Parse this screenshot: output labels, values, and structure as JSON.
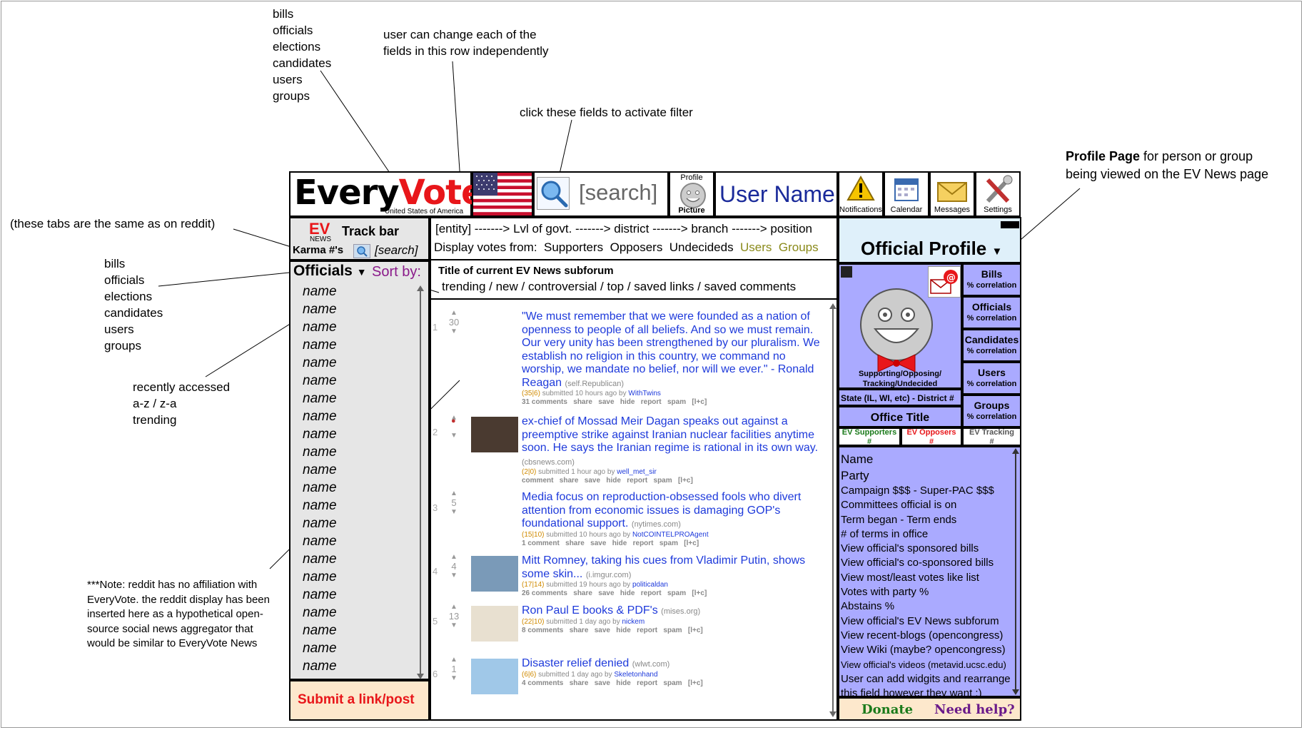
{
  "annotations": {
    "entity_types_top": "bills\nofficials\nelections\ncandidates\nusers\ngroups",
    "fields_note": "user can change each of the\nfields in this row independently",
    "filter_note": "click these fields to activate filter",
    "profile_note_bold": "Profile Page",
    "profile_note_rest": " for person or group\nbeing viewed on the EV News page",
    "tabs_note": "(these tabs are the same as on reddit)",
    "entity_types_left": "bills\nofficials\nelections\ncandidates\nusers\ngroups",
    "sort_note": "recently accessed\na-z / z-a\ntrending",
    "reddit_note": "***Note: reddit has no affiliation with\nEveryVote. the reddit display has been\ninserted here as a hypothetical open-\nsource social news aggregator that\nwould be similar to EveryVote News"
  },
  "header": {
    "logo_every": "Every",
    "logo_vote": "Vote",
    "logo_sub": "United States of America",
    "search_placeholder": "[search]",
    "profile_top": "Profile",
    "profile_bottom": "Picture",
    "user_name": "User Name",
    "icons": [
      {
        "icon": "warning-icon",
        "label": "Notifications"
      },
      {
        "icon": "calendar-icon",
        "label": "Calendar"
      },
      {
        "icon": "envelope-icon",
        "label": "Messages"
      },
      {
        "icon": "tools-icon",
        "label": "Settings"
      }
    ]
  },
  "trackbar": {
    "ev": "EV",
    "news": "NEWS",
    "title": "Track bar",
    "karma": "Karma #'s",
    "search": "[search]"
  },
  "filters": {
    "path": "[entity] -------> Lvl of govt. -------> district -------> branch -------> position",
    "display_label": "Display votes from:",
    "supporters": "Supporters",
    "opposers": "Opposers",
    "undecideds": "Undecideds",
    "users": "Users",
    "groups": "Groups"
  },
  "sidebar": {
    "title": "Officials",
    "sort_by": "Sort by:",
    "items": [
      "name",
      "name",
      "name",
      "name",
      "name",
      "name",
      "name",
      "name",
      "name",
      "name",
      "name",
      "name",
      "name",
      "name",
      "name",
      "name",
      "name",
      "name",
      "name",
      "name",
      "name",
      "name"
    ],
    "submit": "Submit a link/post"
  },
  "subforum": {
    "title": "Title of current EV News subforum",
    "tabs": "trending / new / controversial / top / saved links / saved comments"
  },
  "links": [
    {
      "rank": "1",
      "score": "30",
      "title": "\"We must remember that we were founded as a nation of openness to people of all beliefs. And so we must remain. Our very unity has been strengthened by our pluralism. We establish no religion in this country, we command no worship, we mandate no belief, nor will we ever.\" - Ronald Reagan",
      "domain": "(self.Republican)",
      "points": "(35|6)",
      "submitted": "submitted 10 hours ago by",
      "user": "WithTwins",
      "actions": "31 comments   share   save   hide   report   spam   [l+c]"
    },
    {
      "rank": "2",
      "score": "",
      "title": "ex-chief of Mossad Meir Dagan speaks out against a preemptive strike against Iranian nuclear facilities anytime soon. He says the Iranian regime is rational in its own way.",
      "domain": "(cbsnews.com)",
      "points": "(2|0)",
      "submitted": "submitted 1 hour ago by",
      "user": "well_met_sir",
      "actions": "comment   share   save   hide   report   spam   [l+c]"
    },
    {
      "rank": "3",
      "score": "5",
      "title": "Media focus on reproduction-obsessed fools who divert attention from economic issues is damaging GOP's foundational support.",
      "domain": "(nytimes.com)",
      "points": "(15|10)",
      "submitted": "submitted 10 hours ago by",
      "user": "NotCOINTELPROAgent",
      "actions": "1 comment   share   save   hide   report   spam   [l+c]"
    },
    {
      "rank": "4",
      "score": "4",
      "title": "Mitt Romney, taking his cues from Vladimir Putin, shows some skin...",
      "domain": "(i.imgur.com)",
      "points": "(17|14)",
      "submitted": "submitted 19 hours ago by",
      "user": "politicaldan",
      "actions": "26 comments   share   save   hide   report   spam   [l+c]"
    },
    {
      "rank": "5",
      "score": "13",
      "title": "Ron Paul E books & PDF's",
      "domain": "(mises.org)",
      "points": "(22|10)",
      "submitted": "submitted 1 day ago by",
      "user": "nickem",
      "actions": "8 comments   share   save   hide   report   spam   [l+c]"
    },
    {
      "rank": "6",
      "score": "1",
      "title": "Disaster relief denied",
      "domain": "(wlwt.com)",
      "points": "(6|6)",
      "submitted": "submitted 1 day ago by",
      "user": "Skeletonhand",
      "actions": "4 comments   share   save   hide   report   spam   [l+c]"
    }
  ],
  "profile": {
    "title": "Official Profile",
    "face_caption": "Supporting/Opposing/\nTracking/Undecided",
    "state_line": "State (IL, WI, etc) - District #",
    "office_title": "Office Title",
    "stats": [
      {
        "label": "Bills",
        "sub": "% correlation"
      },
      {
        "label": "Officials",
        "sub": "% correlation"
      },
      {
        "label": "Candidates",
        "sub": "% correlation"
      },
      {
        "label": "Users",
        "sub": "% correlation"
      },
      {
        "label": "Groups",
        "sub": "% correlation"
      }
    ],
    "ev_supporters": "EV Supporters",
    "ev_opposers": "EV Opposers",
    "ev_tracking": "EV Tracking",
    "hash": "#",
    "info": [
      "Name",
      "Party",
      "Campaign $$$ - Super-PAC $$$",
      "Committees official is on",
      "Term began - Term ends",
      "# of terms in office",
      "View official's sponsored bills",
      "View official's co-sponsored bills",
      "View most/least votes like list",
      "Votes with party %",
      "Abstains %",
      "View official's EV News subforum",
      "View recent-blogs (opencongress)",
      "View Wiki (maybe? opencongress)",
      "View official's videos (metavid.ucsc.edu)",
      "User can add widgits and rearrange",
      "this field however they want :)"
    ],
    "donate": "Donate",
    "help": "Need help?"
  },
  "colors": {
    "vote_red": "#e8161a",
    "link_blue": "#1e3adb",
    "profile_lavender": "#aaaaff",
    "sort_purple": "#8a1a8a",
    "olive": "#8a8a1a",
    "donate_green": "#1a7a1a",
    "help_purple": "#6a1a8a"
  }
}
